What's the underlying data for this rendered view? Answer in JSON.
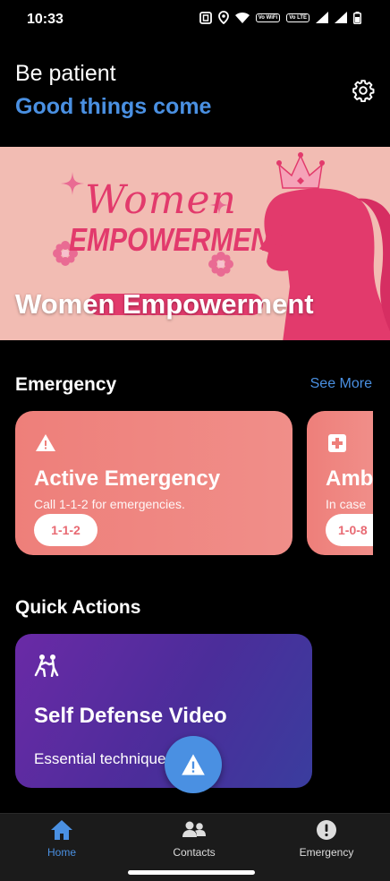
{
  "status_bar": {
    "time": "10:33",
    "chip_wifi": "Vo WiFi",
    "chip_lte": "Vo LTE"
  },
  "header": {
    "line1": "Be patient",
    "line2": "Good things come",
    "settings_icon": "gear-icon",
    "accent_color": "#4a90e2"
  },
  "banner": {
    "art_word1": "Women",
    "art_word2": "EMPOWERMENT",
    "caption": "Women Empowerment",
    "background": "#f2bcb3",
    "accent": "#e23a6c"
  },
  "emergency_section": {
    "title": "Emergency",
    "see_more": "See More",
    "cards": [
      {
        "title": "Active Emergency",
        "subtitle": "Call 1-1-2 for emergencies.",
        "number": "1-1-2",
        "icon": "warning-icon"
      },
      {
        "title": "Amb",
        "subtitle": "In case",
        "number": "1-0-8",
        "icon": "medical-cross-icon"
      }
    ]
  },
  "quick_actions": {
    "title": "Quick Actions",
    "card": {
      "title": "Self Defense Video",
      "subtitle": "Essential techniques",
      "icon": "self-defense-icon"
    }
  },
  "fab": {
    "icon": "warning-icon"
  },
  "bottom_nav": {
    "items": [
      {
        "label": "Home",
        "icon": "home-icon",
        "active": true
      },
      {
        "label": "Contacts",
        "icon": "contacts-icon",
        "active": false
      },
      {
        "label": "Emergency",
        "icon": "alert-circle-icon",
        "active": false
      }
    ]
  }
}
